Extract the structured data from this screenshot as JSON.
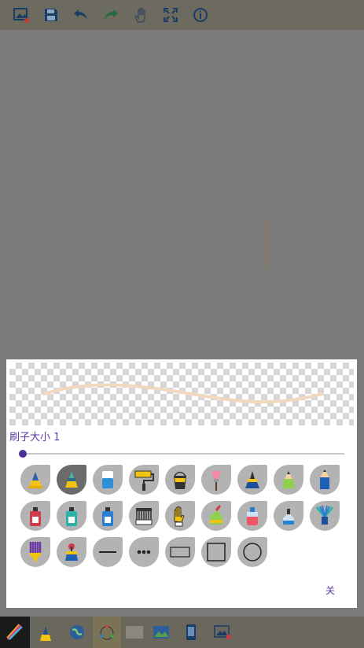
{
  "toolbar": {
    "icons": [
      "image-icon",
      "save-icon",
      "undo-icon",
      "redo-icon",
      "hand-icon",
      "fullscreen-icon",
      "info-icon"
    ]
  },
  "dialog": {
    "size_label": "刷子大小 1",
    "brush_size": 1,
    "close_label": "关",
    "preview_stroke_color": "#f1d9bf",
    "brushes": [
      "pen-brush-icon",
      "marker-brush-icon",
      "eraser-brush-icon",
      "roller-brush-icon",
      "bucket-brush-icon",
      "fan-brush-icon",
      "ink-brush-icon",
      "crayon-brush-icon",
      "pencil-brush-icon",
      "spray-can-red-icon",
      "spray-can-teal-icon",
      "spray-can-blue-icon",
      "comb-brush-icon",
      "glove-brush-icon",
      "glue-bottle-icon",
      "spray-bottle-icon",
      "dropper-bottle-icon",
      "feather-brush-icon",
      "stripe-brush-icon",
      "stamp-brush-icon",
      "line-shape-icon",
      "dots-shape-icon",
      "rectangle-shape-icon",
      "square-shape-icon",
      "circle-shape-icon"
    ]
  },
  "bottom_bar": {
    "icons": [
      "color-pen-icon",
      "brush-tool-icon",
      "globe-icon",
      "shape-tool-icon",
      "blank-canvas-icon",
      "picture-icon",
      "phone-icon",
      "image-edit-icon"
    ]
  },
  "colors": {
    "accent": "#5a3aa6",
    "toolbar_icon": "#1a4f8a",
    "dim_overlay": "#7a7a7a"
  }
}
